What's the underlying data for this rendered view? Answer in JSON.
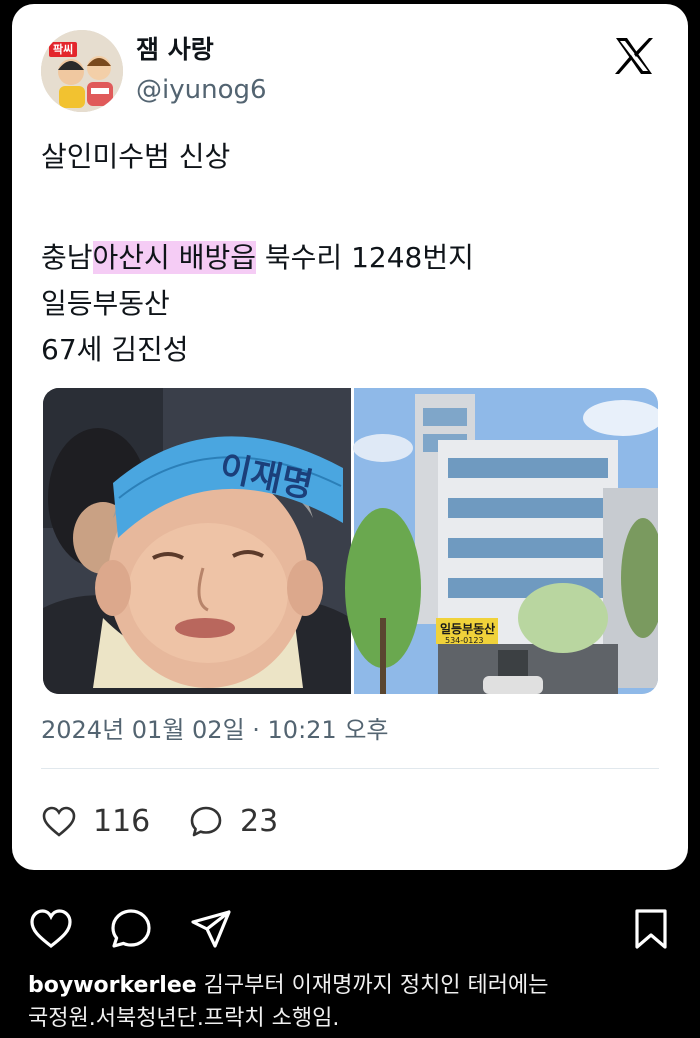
{
  "tweet": {
    "author": {
      "display_name": "잼 사랑",
      "handle": "@iyunog6",
      "avatar_tag": "팍씨"
    },
    "text": {
      "line1": "살인미수범 신상",
      "line2_pre": "충남",
      "line2_highlight": "아산시 배방읍",
      "line2_post": " 북수리 1248번지",
      "line3": "일등부동산",
      "line4": "67세 김진성"
    },
    "media": {
      "left_hat_text": "이재명",
      "sign_text": "일등부동산",
      "sign_phone": "534-0123"
    },
    "timestamp": "2024년 01월 02일 · 10:21 오후",
    "metrics": {
      "likes": "116",
      "replies": "23"
    }
  },
  "instagram": {
    "username": "boyworkerlee",
    "caption_line1": " 김구부터 이재명까지 정치인 테러에는",
    "caption_line2": "국정원.서북청년단.프락치 소행임."
  },
  "colors": {
    "highlight": "#f5ccf5",
    "handle_gray": "#536471",
    "background": "#000000",
    "card": "#ffffff"
  }
}
